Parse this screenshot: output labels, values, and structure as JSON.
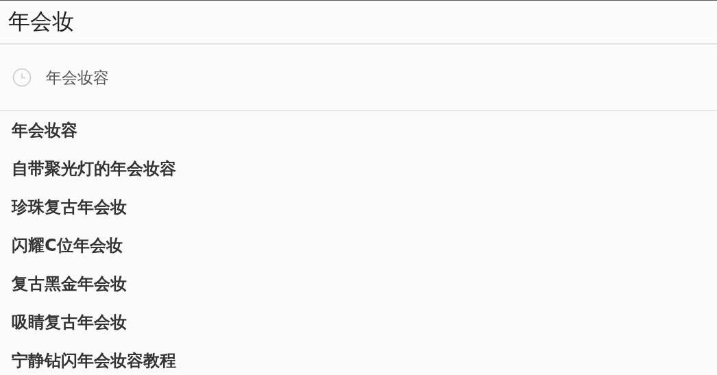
{
  "search": {
    "value": "年会妆"
  },
  "history": [
    {
      "text": "年会妆容"
    }
  ],
  "suggestions": [
    {
      "text": "年会妆容"
    },
    {
      "text": "自带聚光灯的年会妆容"
    },
    {
      "text": "珍珠复古年会妆"
    },
    {
      "text": "闪耀C位年会妆"
    },
    {
      "text": "复古黑金年会妆"
    },
    {
      "text": "吸睛复古年会妆"
    },
    {
      "text": "宁静钻闪年会妆容教程"
    }
  ]
}
